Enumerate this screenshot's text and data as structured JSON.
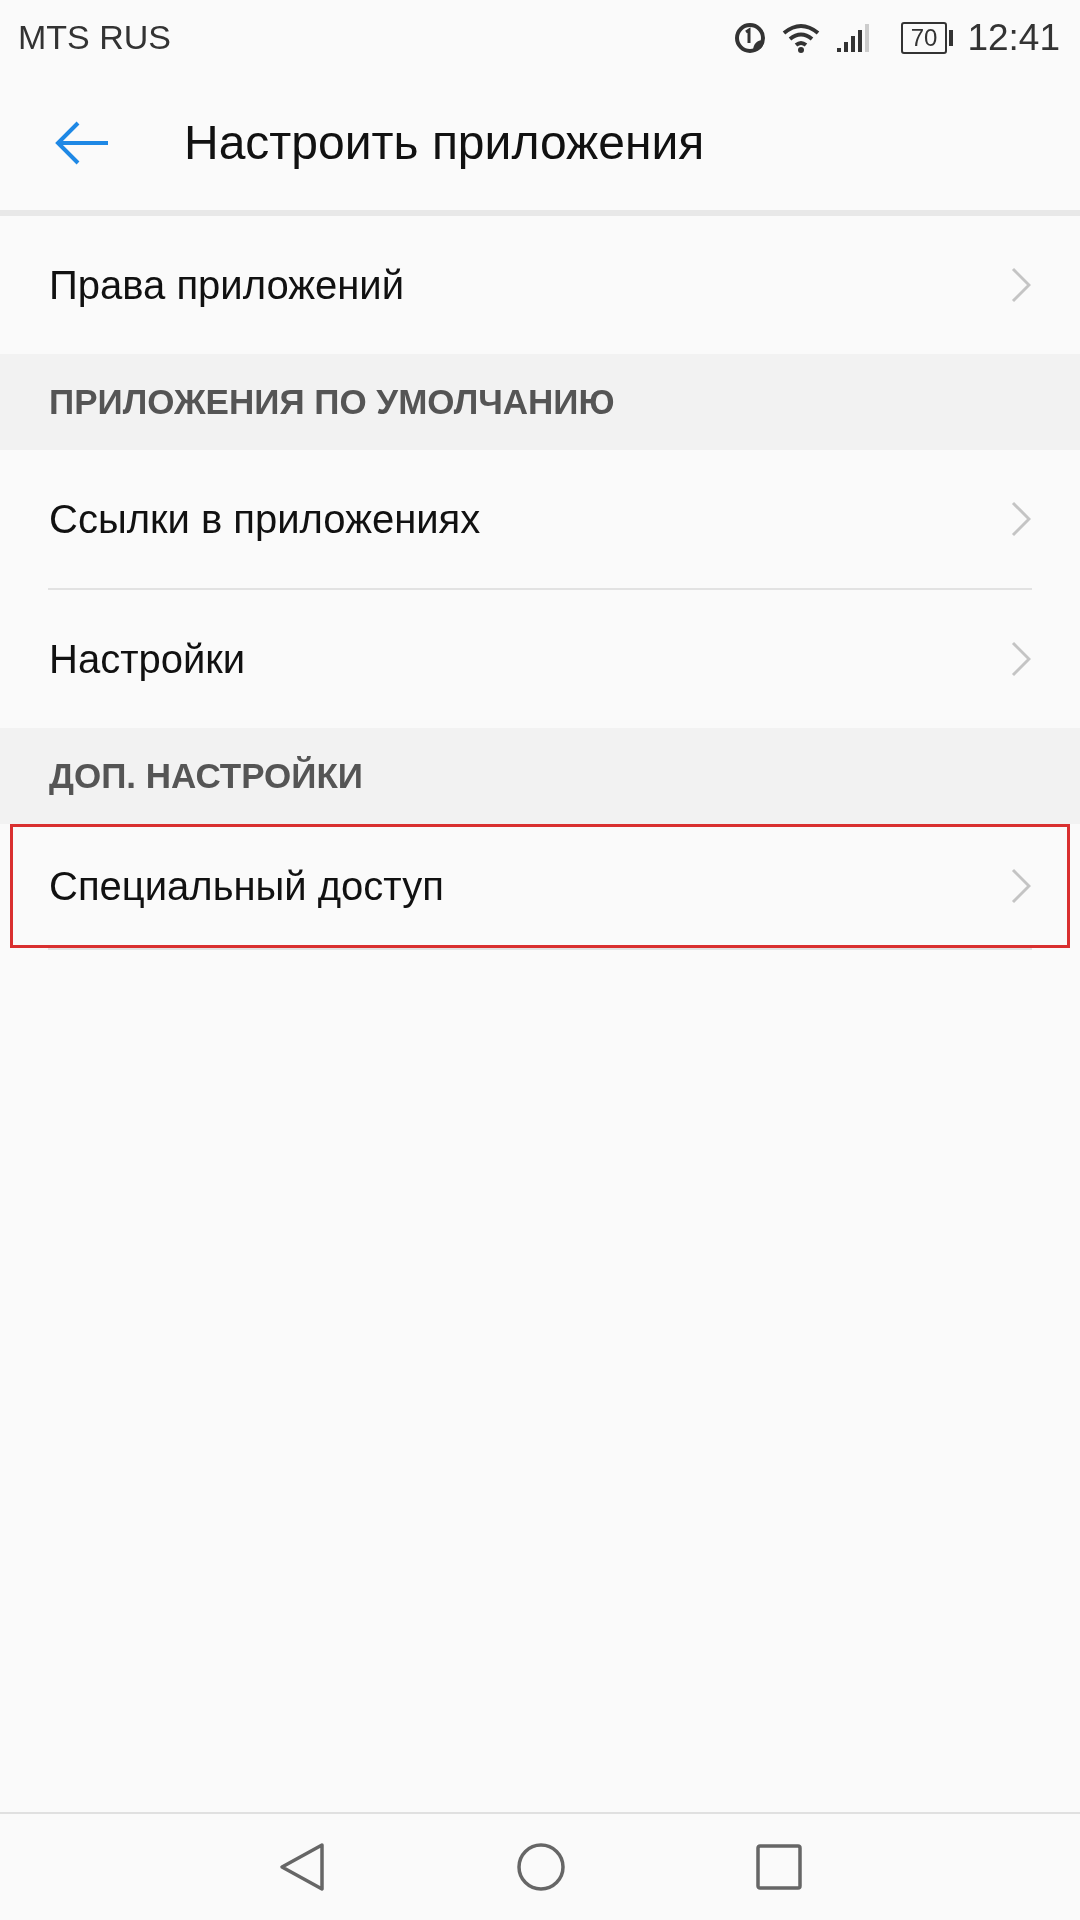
{
  "status_bar": {
    "carrier": "MTS RUS",
    "battery": "70",
    "time": "12:41"
  },
  "header": {
    "title": "Настроить приложения"
  },
  "list": [
    {
      "kind": "item",
      "label": "Права приложений",
      "highlighted": false
    },
    {
      "kind": "section",
      "label": "ПРИЛОЖЕНИЯ ПО УМОЛЧАНИЮ"
    },
    {
      "kind": "item",
      "label": "Ссылки в приложениях",
      "highlighted": false
    },
    {
      "kind": "item",
      "label": "Настройки",
      "highlighted": false
    },
    {
      "kind": "section",
      "label": "ДОП. НАСТРОЙКИ"
    },
    {
      "kind": "item",
      "label": "Специальный доступ",
      "highlighted": true
    }
  ]
}
